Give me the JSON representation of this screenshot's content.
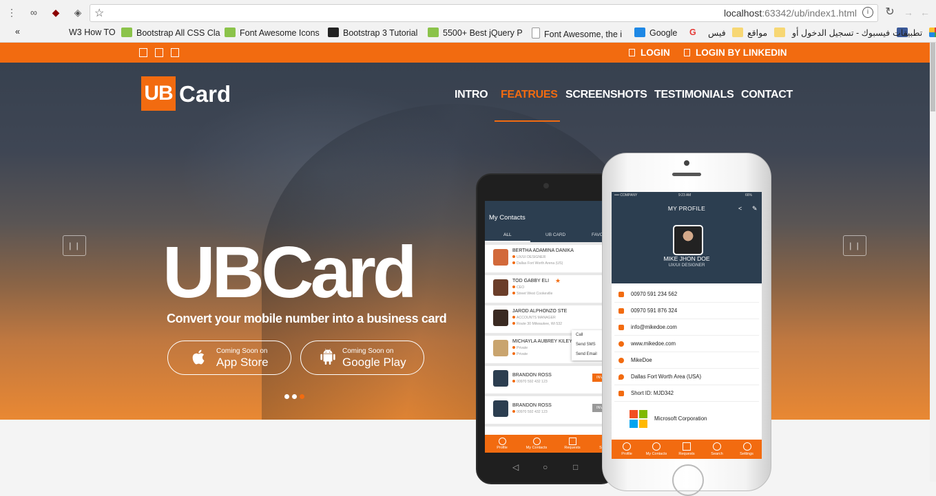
{
  "browser": {
    "url_host": "localhost",
    "url_rest": ":63342/ub/index1.html",
    "bookmarks": [
      {
        "label": "W3 How TO",
        "color": "#ffffff"
      },
      {
        "label": "Bootstrap All CSS Cla",
        "color": "#8bc34a"
      },
      {
        "label": "Font Awesome Icons",
        "color": "#8bc34a"
      },
      {
        "label": "Bootstrap 3 Tutorial",
        "color": "#222222"
      },
      {
        "label": "5500+ Best jQuery P",
        "color": "#8bc34a"
      },
      {
        "label": "Font Awesome, the i",
        "color": "#ffffff"
      },
      {
        "label": "Google",
        "color": "#1e88e5"
      },
      {
        "label": "فيس",
        "color": "#ffffff"
      },
      {
        "label": "مواقع",
        "color": "#f7d774"
      },
      {
        "label": "فيسبوك - تسجيل الدخول أو",
        "color": "#f7d774"
      },
      {
        "label": "تطبيقات",
        "color": "#3b5998"
      }
    ],
    "chevron": "«"
  },
  "topbar": {
    "login": "LOGIN",
    "login_linkedin": "LOGIN BY LINKEDIN"
  },
  "logo": {
    "box": "UB",
    "word": "Card"
  },
  "nav": [
    "INTRO",
    "FEATRUES",
    "SCREENSHOTS",
    "TESTIMONIALS",
    "CONTACT"
  ],
  "hero": {
    "title": "UBCard",
    "subtitle": "Convert your mobile number into a business card",
    "arrows": [
      "| |",
      "| |"
    ],
    "app_store": {
      "small": "Coming Soon on",
      "big": "App Store"
    },
    "google_play": {
      "small": "Coming Soon on",
      "big": "Google Play"
    }
  },
  "android": {
    "header": "My Contacts",
    "tabs": [
      "ALL",
      "UB CARD",
      "FAVO"
    ],
    "contacts": [
      {
        "name": "BERTHA ADAMINA DANIKA",
        "line1": "UX/UI DESIGNER",
        "line2": "Dallas Fort Worth Arena (US)",
        "avatar": "#d2693a"
      },
      {
        "name": "TOD GABBY ELI",
        "line1": "CEO",
        "line2": "Street West Cookeville",
        "avatar": "#6b3e2a"
      },
      {
        "name": "JAROD ALPHONZO STE",
        "line1": "ACCOUNTS MANAGER",
        "line2": "Route 30 Milwaukee, Wi 532",
        "avatar": "#3a2a22"
      },
      {
        "name": "MICHAYLA AUBREY KILEY",
        "line1": "Private",
        "line2": "Private",
        "avatar": "#c9a46e"
      },
      {
        "name": "BRANDON ROSS",
        "line1": "00970 592 432 123",
        "line2": "",
        "avatar": "#2c3e50"
      },
      {
        "name": "BRANDON ROSS",
        "line1": "00970 592 432 123",
        "line2": "",
        "avatar": "#2c3e50"
      }
    ],
    "invite": "INV",
    "popup": [
      "Call",
      "Send SMS",
      "Send Email"
    ],
    "bottom": [
      "Profile",
      "My Contacts",
      "Requests",
      "S"
    ]
  },
  "iphone": {
    "status_left": "•••• COMPANY",
    "status_mid": "9:23 AM",
    "status_right": "66%",
    "title": "MY PROFILE",
    "name": "MIKE JHON DOE",
    "role": "UX/UI DESIGNER",
    "rows": [
      "00970 591 234 562",
      "00970 591 876 324",
      "info@mikedoe.com",
      "www.mikedoe.com",
      "MikeDoe",
      "Dallas Fort Worth Area (USA)",
      "Short ID: MJD342"
    ],
    "company": "Microsoft Corporation",
    "bottom": [
      "Profile",
      "My Contacts",
      "Requests",
      "Search",
      "Settings"
    ]
  },
  "colors": {
    "accent": "#f26b10",
    "dark": "#2c3e50"
  }
}
